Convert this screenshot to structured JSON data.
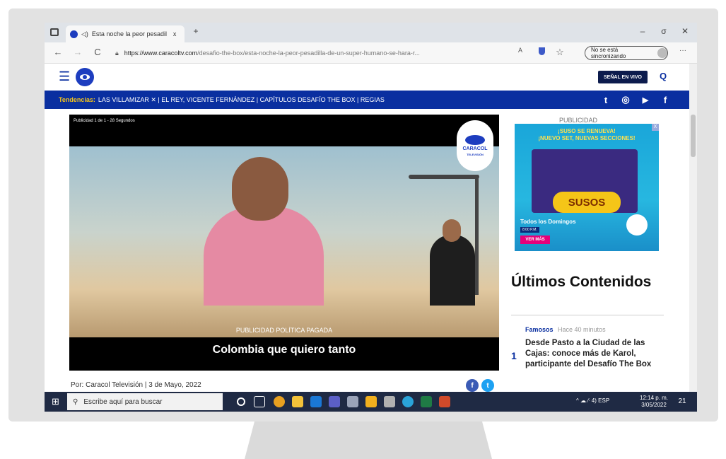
{
  "browser": {
    "tab_title": "Esta noche la peor pesadil",
    "url_domain": "https://www.caracoltv.com",
    "url_path": "/desafio-the-box/esta-noche-la-peor-pesadilla-de-un-super-humano-se-hara-r...",
    "sync_status": "No se está sincronizando",
    "tab_close": "x",
    "new_tab": "+",
    "minimize": "–",
    "restore": "σ",
    "close": "✕",
    "back": "←",
    "forward": "→",
    "refresh": "C",
    "more": "···"
  },
  "site": {
    "menu_icon": "☰",
    "live_button": "SEÑAL EN VIVO",
    "search_icon": "Q"
  },
  "trends": {
    "label": "Tendencias:",
    "items": "LAS VILLAMIZAR ✕ | EL REY, VICENTE FERNÁNDEZ | CAPÍTULOS DESAFÍO THE BOX | REGIAS"
  },
  "social": {
    "twitter": "t",
    "instagram": "◎",
    "youtube": "▶",
    "facebook": "f"
  },
  "video": {
    "ad_label": "Publicidad 1 de 1 - 28 Segundos",
    "badge_line1": "CARACOL",
    "badge_line2": "TELEVISIÓN",
    "political_label": "PUBLICIDAD POLÍTICA PAGADA",
    "caption": "Colombia que quiero tanto"
  },
  "article": {
    "byline": "Por: Caracol Televisión | 3 de Mayo, 2022"
  },
  "sidebar": {
    "pub_label": "PUBLICIDAD",
    "ad": {
      "headline_1": "¡SUSO SE RENUEVA!",
      "headline_2": "¡NUEVO SET, NUEVAS SECCIONES!",
      "title": "SUSOS",
      "subtitle": "Todos los Domingos",
      "time": "8:00 P.M.",
      "cta": "VER MÁS",
      "close": "X"
    },
    "latest_title": "Últimos Contenidos",
    "news": {
      "category": "Famosos",
      "time": "Hace 40 minutos",
      "number": "1",
      "title": "Desde Pasto a la Ciudad de las Cajas: conoce más de Karol, participante del Desafío The Box"
    }
  },
  "taskbar": {
    "start": "⊞",
    "search_placeholder": "Escribe aquí para buscar",
    "tray": "^ ☁ ⁄ᐧ 4) ESP",
    "time": "12:14 p. m.",
    "date": "3/05/2022",
    "notifications": "21"
  }
}
